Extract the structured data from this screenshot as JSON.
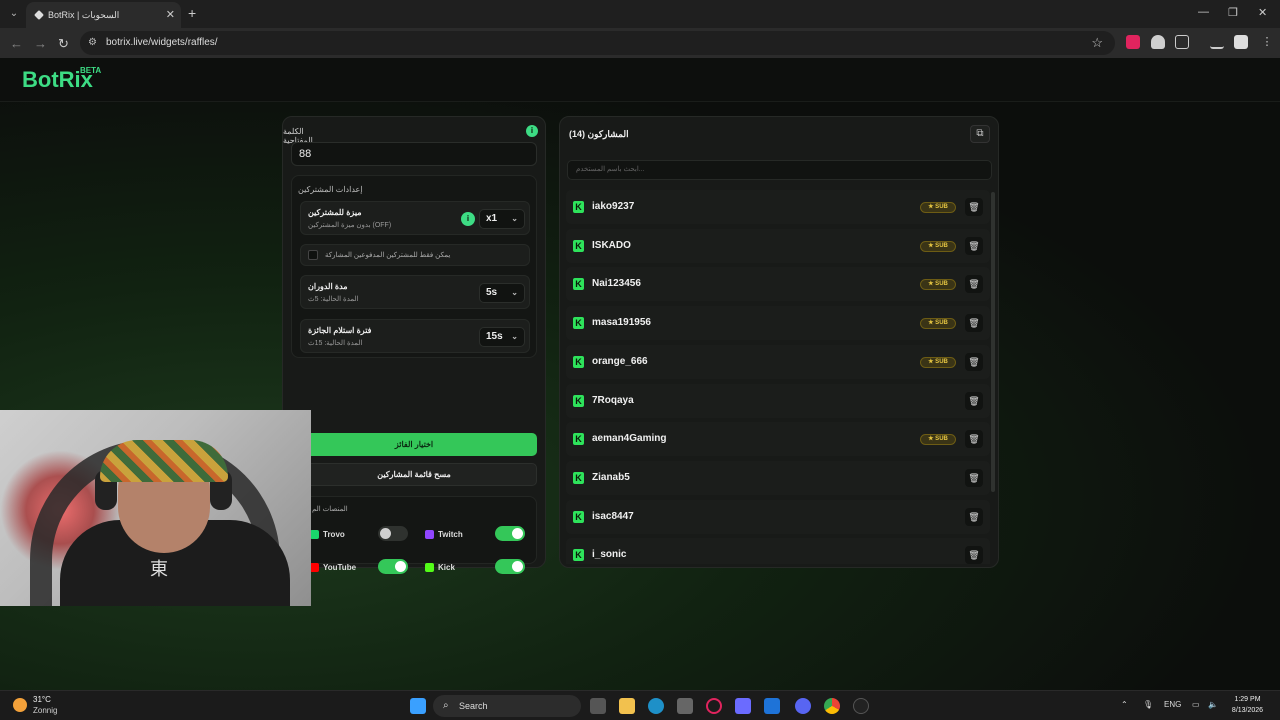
{
  "browser": {
    "tab_title": "BotRix | السحوبات",
    "url": "botrix.live/widgets/raffles/"
  },
  "app": {
    "logo": "BotRix",
    "beta": "BETA"
  },
  "raffle": {
    "keyword_label": "الكلمة المفتاحية",
    "keyword_value": "88",
    "info": "i",
    "subscriber_settings_title": "إعدادات المشتركين",
    "sub_perk_label": "ميزة للمشتركين",
    "sub_perk_sub": "بدون ميزة المشتركين (OFF)",
    "sub_perk_value": "x1",
    "paid_only_label": "يمكن فقط للمشتركين المدفوعين المشاركة",
    "spin_label": "مدة الدوران",
    "spin_sub": "المدة الحالية: 5ث",
    "spin_value": "5s",
    "claim_label": "فترة استلام الجائزة",
    "claim_sub": "المدة الحالية: 15ث",
    "claim_value": "15s",
    "pick_winner": "اختيار الفائز",
    "clear_list": "مسح قائمة المشاركين",
    "platforms_title": "المنصات الم",
    "platforms": [
      {
        "name": "Trovo",
        "on": false,
        "color": "#19d66b"
      },
      {
        "name": "Twitch",
        "on": true,
        "color": "#9146ff"
      },
      {
        "name": "YouTube",
        "on": true,
        "color": "#ff0000"
      },
      {
        "name": "Kick",
        "on": true,
        "color": "#53fc18"
      }
    ]
  },
  "participants": {
    "title": "المشاركون (14)",
    "search_placeholder": "ابحث باسم المستخدم...",
    "sub_badge": "★ SUB",
    "platform_letter": "K",
    "items": [
      {
        "name": "iako9237",
        "sub": true
      },
      {
        "name": "ISKADO",
        "sub": true
      },
      {
        "name": "Nai123456",
        "sub": true
      },
      {
        "name": "masa191956",
        "sub": true
      },
      {
        "name": "orange_666",
        "sub": true
      },
      {
        "name": "7Roqaya",
        "sub": false
      },
      {
        "name": "aeman4Gaming",
        "sub": true
      },
      {
        "name": "Zianab5",
        "sub": false
      },
      {
        "name": "isac8447",
        "sub": false
      },
      {
        "name": "i_sonic",
        "sub": false
      }
    ]
  },
  "taskbar": {
    "temp": "31°C",
    "condition": "Zonnig",
    "search": "Search",
    "lang": "ENG",
    "time": "1:29 PM",
    "date": "8/13/2026"
  },
  "colors": {
    "accent": "#3ddc84",
    "kick": "#2ee35b",
    "sub_badge": "#e5c542"
  }
}
